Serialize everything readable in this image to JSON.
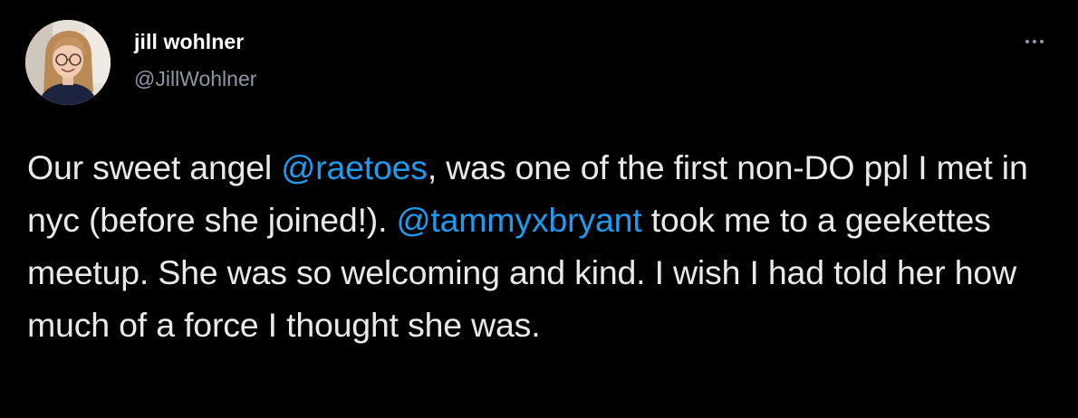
{
  "author": {
    "display_name": "jill wohlner",
    "handle": "@JillWohlner",
    "avatar_icon": "profile-photo"
  },
  "menu": {
    "icon": "more-horizontal-icon"
  },
  "tweet": {
    "segments": {
      "s1": "Our sweet angel ",
      "m1": "@raetoes",
      "s2": ", was one of the first non-DO ppl I met in nyc (before she joined!). ",
      "m2": "@tammyxbryant",
      "s3": " took me to a geekettes meetup. She was so welcoming and kind. I wish I had told her how much of a force I thought she was."
    }
  },
  "colors": {
    "background": "#000000",
    "text": "#e7e9ea",
    "secondary": "#8b98a5",
    "link": "#1d9bf0"
  }
}
